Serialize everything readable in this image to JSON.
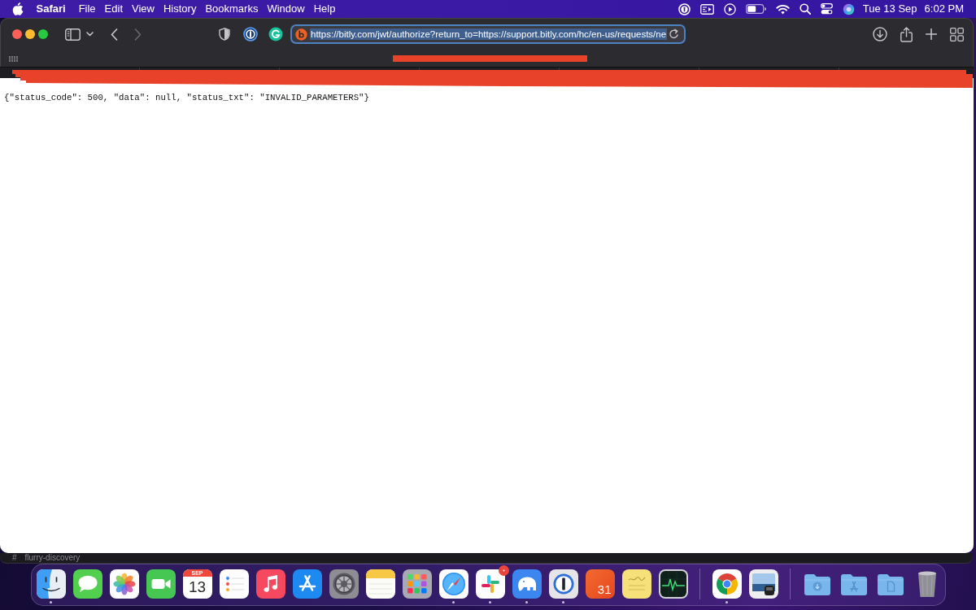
{
  "menu_bar": {
    "app_name": "Safari",
    "menus": [
      "File",
      "Edit",
      "View",
      "History",
      "Bookmarks",
      "Window",
      "Help"
    ],
    "date": "Tue 13 Sep",
    "time": "6:02 PM"
  },
  "browser": {
    "toolbar": {
      "nav_buttons": [
        {
          "disabled": false
        },
        {
          "disabled": true
        }
      ],
      "address": {
        "url": "https://bitly.com/jwt/authorize?return_to=https://support.bitly.com/hc/en-us/requests/ne",
        "selected": true,
        "focused": true
      }
    },
    "page": {
      "body": "{\"status_code\": 500, \"data\": null, \"status_txt\": \"INVALID_PARAMETERS\"}"
    }
  },
  "background_window": {
    "hash": "#",
    "channel": "flurry-discovery"
  },
  "dock": {
    "apps": [
      {
        "running": true,
        "badge": false
      },
      {
        "running": false,
        "badge": false
      },
      {
        "running": false,
        "badge": false
      },
      {
        "running": false,
        "badge": false
      },
      {
        "running": false,
        "badge": false,
        "month": "SEP",
        "day": "13"
      },
      {
        "running": false,
        "badge": false
      },
      {
        "running": false,
        "badge": false
      },
      {
        "running": false,
        "badge": false
      },
      {
        "running": false,
        "badge": false
      },
      {
        "running": false,
        "badge": false
      },
      {
        "running": false,
        "badge": false
      },
      {
        "running": true,
        "badge": false
      },
      {
        "running": true,
        "badge": true
      },
      {
        "running": true,
        "badge": false
      },
      {
        "running": true,
        "badge": false
      },
      {
        "running": false,
        "badge": false,
        "day": "31"
      },
      {
        "running": false,
        "badge": false
      },
      {
        "running": false,
        "badge": false
      }
    ],
    "suggested": [
      {
        "running": true
      },
      {
        "running": false
      }
    ]
  }
}
